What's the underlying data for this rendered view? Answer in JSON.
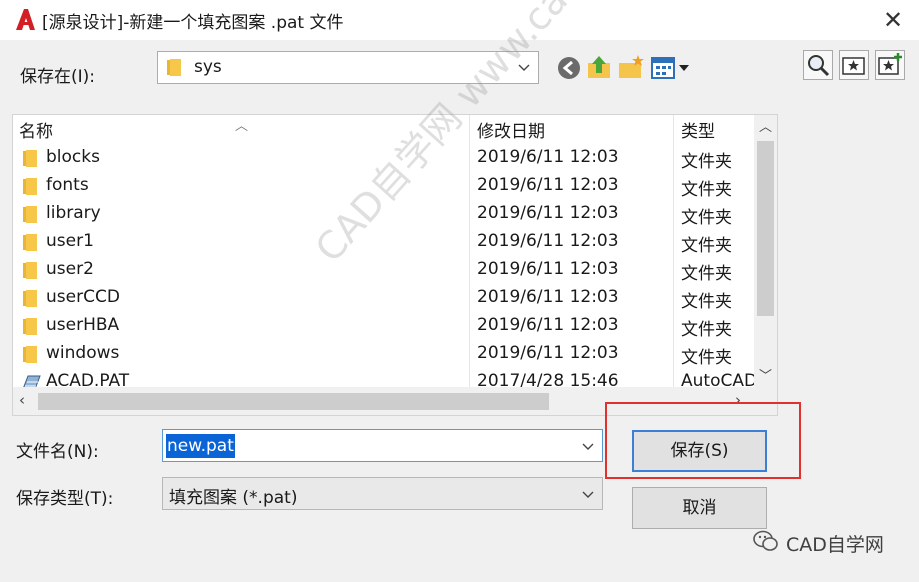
{
  "window": {
    "title": "[源泉设计]-新建一个填充图案 .pat 文件"
  },
  "save_in": {
    "label": "保存在(I):",
    "value": "sys"
  },
  "toolbar": {
    "back": "back-icon",
    "up": "up-folder-icon",
    "new_folder": "new-folder-icon",
    "views": "views-icon",
    "right": [
      "search-web-icon",
      "favorites-icon",
      "add-favorites-icon"
    ]
  },
  "file_list": {
    "columns": {
      "name": "名称",
      "date": "修改日期",
      "type": "类型"
    },
    "rows": [
      {
        "name": "blocks",
        "date": "2019/6/11 12:03",
        "type": "文件夹",
        "icon": "folder-icon"
      },
      {
        "name": "fonts",
        "date": "2019/6/11 12:03",
        "type": "文件夹",
        "icon": "folder-icon"
      },
      {
        "name": "library",
        "date": "2019/6/11 12:03",
        "type": "文件夹",
        "icon": "folder-icon"
      },
      {
        "name": "user1",
        "date": "2019/6/11 12:03",
        "type": "文件夹",
        "icon": "folder-icon"
      },
      {
        "name": "user2",
        "date": "2019/6/11 12:03",
        "type": "文件夹",
        "icon": "folder-icon"
      },
      {
        "name": "userCCD",
        "date": "2019/6/11 12:03",
        "type": "文件夹",
        "icon": "folder-icon"
      },
      {
        "name": "userHBA",
        "date": "2019/6/11 12:03",
        "type": "文件夹",
        "icon": "folder-icon"
      },
      {
        "name": "windows",
        "date": "2019/6/11 12:03",
        "type": "文件夹",
        "icon": "folder-icon"
      },
      {
        "name": "ACAD.PAT",
        "date": "2017/4/28 15:46",
        "type": "AutoCAD",
        "icon": "pat-file-icon"
      }
    ]
  },
  "file_name": {
    "label": "文件名(N):",
    "value": "new.pat"
  },
  "file_type": {
    "label": "保存类型(T):",
    "value": "填充图案 (*.pat)"
  },
  "buttons": {
    "save": "保存(S)",
    "cancel": "取消"
  },
  "watermark": "CAD自学网 www.cadzxw.com",
  "brand": "CAD自学网",
  "colors": {
    "selection": "#0a64d6",
    "highlight_box": "#e0312f",
    "app_icon": "#d21f26"
  }
}
